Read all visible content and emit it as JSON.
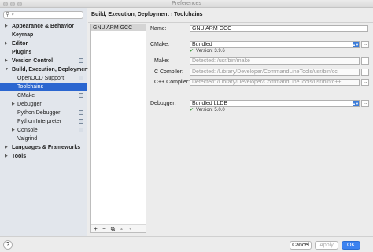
{
  "window": {
    "title": "Preferences"
  },
  "search": {
    "value": "",
    "placeholder": ""
  },
  "sidebar": {
    "items": [
      {
        "label": "Appearance & Behavior"
      },
      {
        "label": "Keymap"
      },
      {
        "label": "Editor"
      },
      {
        "label": "Plugins"
      },
      {
        "label": "Version Control"
      },
      {
        "label": "Build, Execution, Deployment"
      },
      {
        "label": "OpenOCD Support"
      },
      {
        "label": "Toolchains"
      },
      {
        "label": "CMake"
      },
      {
        "label": "Debugger"
      },
      {
        "label": "Python Debugger"
      },
      {
        "label": "Python Interpreter"
      },
      {
        "label": "Console"
      },
      {
        "label": "Valgrind"
      },
      {
        "label": "Languages & Frameworks"
      },
      {
        "label": "Tools"
      }
    ]
  },
  "breadcrumb": {
    "parent": "Build, Execution, Deployment",
    "separator": "›",
    "current": "Toolchains"
  },
  "toolchains": {
    "items": [
      "GNU ARM GCC"
    ],
    "toolbar": {
      "add": "+",
      "remove": "−",
      "copy": "⧉",
      "up": "▲",
      "down": "▼"
    }
  },
  "form": {
    "name_label": "Name:",
    "name_value": "GNU ARM GCC",
    "cmake_label": "CMake:",
    "cmake_value": "Bundled",
    "cmake_version": "Version: 3.9.6",
    "make_label": "Make:",
    "make_value": "Detected: /usr/bin/make",
    "c_compiler_label": "C Compiler:",
    "c_compiler_value": "Detected: /Library/Developer/CommandLineTools/usr/bin/cc",
    "cpp_compiler_label": "C++ Compiler:",
    "cpp_compiler_value": "Detected: /Library/Developer/CommandLineTools/usr/bin/c++",
    "debugger_label": "Debugger:",
    "debugger_value": "Bundled LLDB",
    "debugger_version": "Version: 5.0.0",
    "more_label": "..."
  },
  "footer": {
    "help": "?",
    "cancel": "Cancel",
    "apply": "Apply",
    "ok": "OK"
  },
  "colors": {
    "accent": "#2b66d0",
    "ok_button": "#3b82f0",
    "check": "#3a9a3a"
  }
}
